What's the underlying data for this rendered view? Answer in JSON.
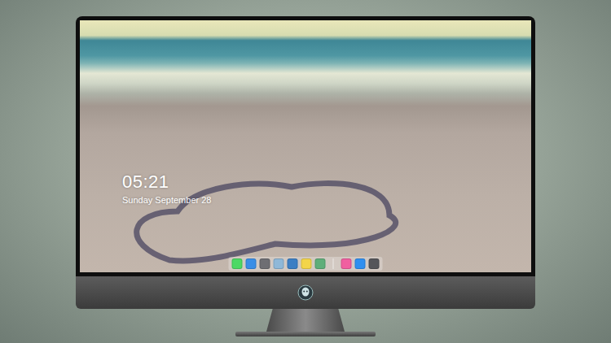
{
  "clock": {
    "time": "05:21",
    "date": "Sunday September 28"
  },
  "dock": {
    "items": [
      {
        "kind": "app",
        "color": "#4cd964"
      },
      {
        "kind": "app",
        "color": "#3a8ee6"
      },
      {
        "kind": "app",
        "color": "#6e6e73"
      },
      {
        "kind": "app",
        "color": "#8fb8d8"
      },
      {
        "kind": "app",
        "color": "#3d7fc4"
      },
      {
        "kind": "app",
        "color": "#f3d54a"
      },
      {
        "kind": "app",
        "color": "#5fae7a"
      },
      {
        "kind": "separator"
      },
      {
        "kind": "app",
        "color": "#f05fa0"
      },
      {
        "kind": "app",
        "color": "#2f8ff0"
      },
      {
        "kind": "app",
        "color": "#55565a"
      }
    ]
  }
}
